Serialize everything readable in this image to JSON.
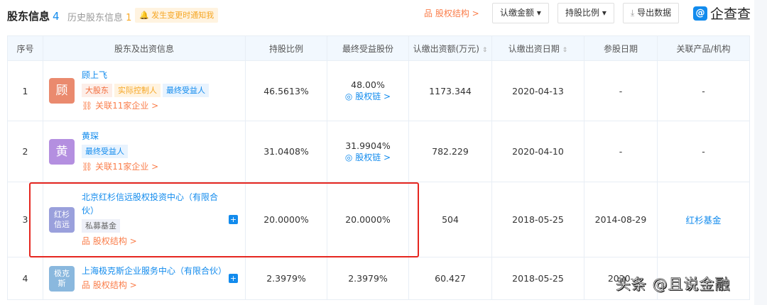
{
  "header": {
    "title": "股东信息",
    "count": "4",
    "history_label": "历史股东信息",
    "history_count": "1",
    "notify": "发生变更时通知我",
    "structure_link": "股权结构 >",
    "btn_amount": "认缴金额 ▾",
    "btn_ratio": "持股比例 ▾",
    "btn_export": "导出数据",
    "logo": "企查查"
  },
  "columns": [
    "序号",
    "股东及出资信息",
    "持股比例",
    "最终受益股份",
    "认缴出资额(万元)",
    "认缴出资日期",
    "参股日期",
    "关联产品/机构"
  ],
  "rows": [
    {
      "index": "1",
      "avatar": "顾",
      "avatar_color": "#ea8a6e",
      "name": "顾上飞",
      "tags": [
        "大股东",
        "实际控制人",
        "最终受益人"
      ],
      "link": "关联11家企业 >",
      "ratio": "46.5613%",
      "benefit": "48.00%",
      "chain": "股权链 >",
      "amount": "1173.344",
      "date": "2020-04-13",
      "join_date": "-",
      "product": "-"
    },
    {
      "index": "2",
      "avatar": "黄",
      "avatar_color": "#b48fe0",
      "name": "黄琛",
      "tags": [
        "最终受益人"
      ],
      "link": "关联11家企业 >",
      "ratio": "31.0408%",
      "benefit": "31.9904%",
      "chain": "股权链 >",
      "amount": "782.229",
      "date": "2020-04-10",
      "join_date": "-",
      "product": "-"
    },
    {
      "index": "3",
      "avatar": "红杉信远",
      "avatar_color": "#9aa0dc",
      "name": "北京红杉信远股权投资中心（有限合伙）",
      "tags": [
        "私募基金"
      ],
      "link": "股权结构 >",
      "ratio": "20.0000%",
      "benefit": "20.0000%",
      "amount": "504",
      "date": "2018-05-25",
      "join_date": "2014-08-29",
      "product": "红杉基金"
    },
    {
      "index": "4",
      "avatar": "极克斯",
      "avatar_color": "#8ab8de",
      "name": "上海极克斯企业服务中心（有限合伙）",
      "link": "股权结构 >",
      "ratio": "2.3979%",
      "benefit": "2.3979%",
      "amount": "60.427",
      "date": "2018-05-25",
      "join_date": "2020-"
    }
  ],
  "watermark": "头条 @且说金融"
}
